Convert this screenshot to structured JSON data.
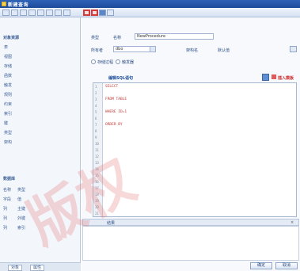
{
  "window": {
    "title": "新建查询"
  },
  "left_panel": {
    "categories": [
      {
        "label": "对象资源"
      },
      {
        "label": "数据库"
      }
    ],
    "items": [
      "表",
      "视图",
      "存储",
      "函数",
      "触发",
      "规则",
      "约束",
      "索引",
      "键",
      "类型",
      "架构"
    ],
    "rows": [
      {
        "c1": "名称",
        "c2": "类型"
      },
      {
        "c1": "字段",
        "c2": "值"
      },
      {
        "c1": "列",
        "c2": "主键"
      },
      {
        "c1": "列",
        "c2": "外键"
      },
      {
        "c1": "列",
        "c2": "索引"
      }
    ],
    "tabs": [
      "对象",
      "属性"
    ]
  },
  "form": {
    "type_label": "类型",
    "name_label": "名称",
    "name_value": "NewProcedure",
    "owner_label": "所有者",
    "owner_value": "dbo",
    "schema_label": "架构名",
    "schema_value": "默认值",
    "radio_1": "存储过程",
    "radio_2": "触发器"
  },
  "editor": {
    "section_title": "编辑SQL语句",
    "link_label": "插入模板",
    "lines": [
      "1",
      "2",
      "3",
      "4",
      "5",
      "6",
      "7",
      "8",
      "9",
      "10",
      "11",
      "12",
      "13",
      "14",
      "15",
      "16",
      "17",
      "18",
      "19",
      "20",
      "21"
    ],
    "code": [
      "SELECT",
      "",
      "FROM TABLE",
      "",
      "WHERE ID=1",
      "",
      "ORDER BY"
    ]
  },
  "lower": {
    "bar_label": "结果",
    "close_label": "×"
  },
  "buttons": {
    "ok": "确定",
    "cancel": "取消"
  },
  "watermark": "版权"
}
